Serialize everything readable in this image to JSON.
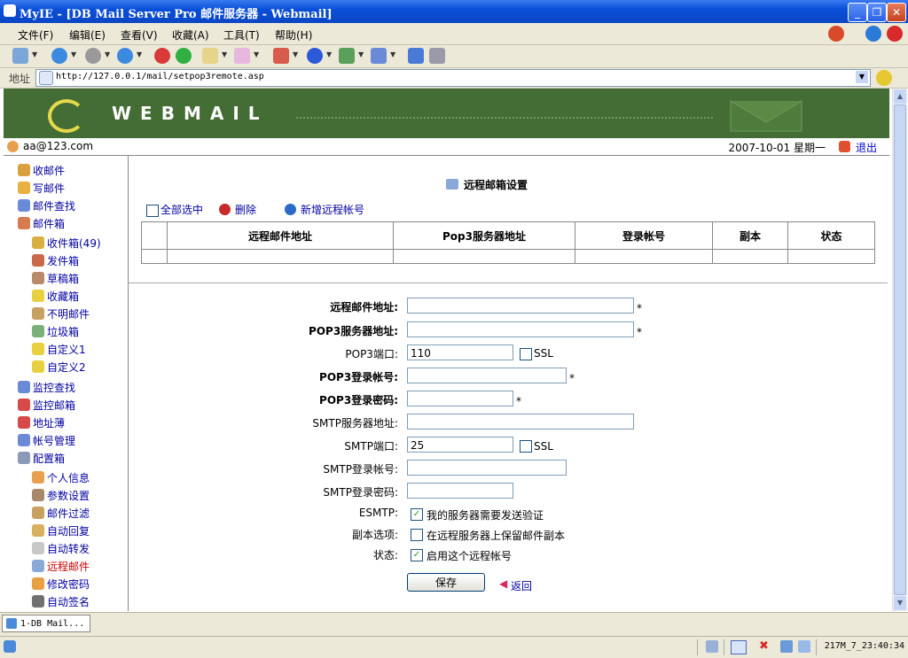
{
  "window": {
    "title": "MyIE - [DB Mail Server Pro 邮件服务器 - Webmail]"
  },
  "menu": [
    "文件(F)",
    "编辑(E)",
    "查看(V)",
    "收藏(A)",
    "工具(T)",
    "帮助(H)"
  ],
  "address": {
    "label": "地址",
    "url": "http://127.0.0.1/mail/setpop3remote.asp"
  },
  "banner": {
    "brand": "WEBMAIL"
  },
  "userbar": {
    "user": "aa@123.com",
    "datetime": "2007-10-01 星期一",
    "logout": "退出"
  },
  "nav": {
    "inbox": "收邮件",
    "compose": "写邮件",
    "search": "邮件查找",
    "mailbox": "邮件箱",
    "folders": [
      "收件箱(49)",
      "发件箱",
      "草稿箱",
      "收藏箱",
      "不明邮件",
      "垃圾箱",
      "自定义1",
      "自定义2"
    ],
    "monitor_search": "监控查找",
    "monitor_box": "监控邮箱",
    "addressbook": "地址薄",
    "account": "帐号管理",
    "config": "配置箱",
    "config_items": [
      "个人信息",
      "参数设置",
      "邮件过滤",
      "自动回复",
      "自动转发",
      "远程邮件",
      "修改密码",
      "自动签名"
    ]
  },
  "page": {
    "title": "远程邮箱设置",
    "select_all": "全部选中",
    "delete": "删除",
    "add_remote": "新增远程帐号",
    "table_headers": [
      "远程邮件地址",
      "Pop3服务器地址",
      "登录帐号",
      "副本",
      "状态"
    ]
  },
  "form": {
    "remote_addr_label": "远程邮件地址:",
    "pop3_server_label": "POP3服务器地址:",
    "pop3_port_label": "POP3端口:",
    "pop3_port_value": "110",
    "ssl_label": "SSL",
    "pop3_user_label": "POP3登录帐号:",
    "pop3_pass_label": "POP3登录密码:",
    "smtp_server_label": "SMTP服务器地址:",
    "smtp_port_label": "SMTP端口:",
    "smtp_port_value": "25",
    "smtp_user_label": "SMTP登录帐号:",
    "smtp_pass_label": "SMTP登录密码:",
    "esmtp_label": "ESMTP:",
    "esmtp_text": "我的服务器需要发送验证",
    "copy_label": "副本选项:",
    "copy_text": "在远程服务器上保留邮件副本",
    "status_label": "状态:",
    "status_text": "启用这个远程帐号",
    "required": "*",
    "save": "保存",
    "back": "返回"
  },
  "tabs": [
    {
      "label": "1-DB Mail..."
    }
  ],
  "statusbar": {
    "clock": "217M_7_23:40:34"
  }
}
